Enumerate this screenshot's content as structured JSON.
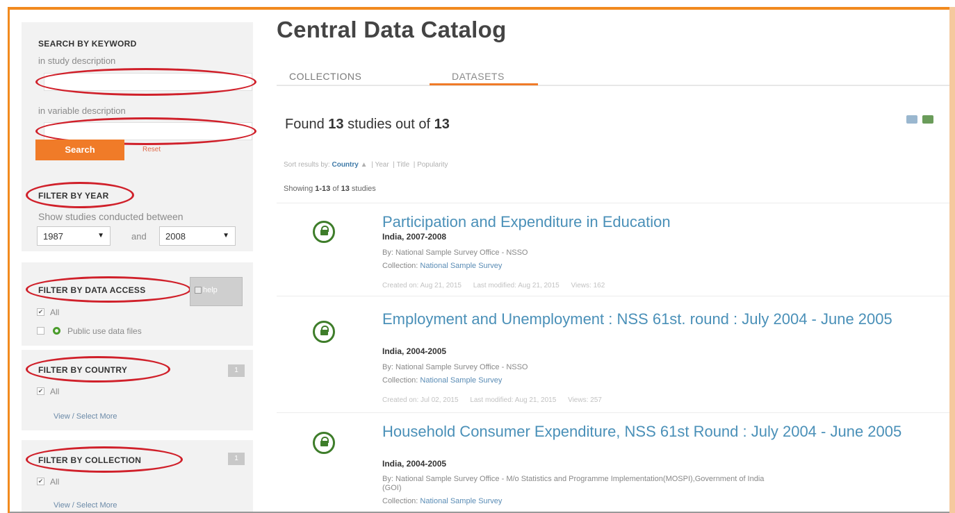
{
  "sidebar": {
    "keyword": {
      "title": "SEARCH BY KEYWORD",
      "study_label": "in study description",
      "variable_label": "in variable description",
      "study_value": "",
      "variable_value": "",
      "search_label": "Search",
      "reset_label": "Reset"
    },
    "year": {
      "title": "FILTER BY YEAR",
      "hint": "Show studies conducted between",
      "from": "1987",
      "and_label": "and",
      "to": "2008"
    },
    "access": {
      "title": "FILTER BY DATA ACCESS",
      "help_alt": "help",
      "all_label": "All",
      "public_label": "Public use data files"
    },
    "country": {
      "title": "FILTER BY COUNTRY",
      "count": "1",
      "all_label": "All",
      "more_label": "View / Select More"
    },
    "collection": {
      "title": "FILTER BY COLLECTION",
      "count": "1",
      "all_label": "All",
      "more_label": "View / Select More"
    }
  },
  "main": {
    "title": "Central Data Catalog",
    "tabs": [
      {
        "label": "COLLECTIONS"
      },
      {
        "label": "DATASETS"
      }
    ],
    "found": {
      "prefix": "Found",
      "count": "13",
      "mid": "studies out of",
      "total": "13"
    },
    "sort": {
      "prefix": "Sort results by:",
      "active": "Country",
      "arrow": "▲",
      "year": "Year",
      "title": "Title",
      "popularity": "Popularity"
    },
    "showing": {
      "prefix": "Showing",
      "range": "1-13",
      "of": "of",
      "total": "13",
      "suffix": "studies"
    },
    "studies": [
      {
        "title": "Participation and Expenditure in Education",
        "country": "India, 2007-2008",
        "by": "By: National Sample Survey Office - NSSO",
        "collection_prefix": "Collection:",
        "collection": "National Sample Survey",
        "created": "Created on: Aug 21, 2015",
        "modified": "Last modified: Aug 21, 2015",
        "views": "Views: 162"
      },
      {
        "title": "Employment and Unemployment : NSS 61st. round : July 2004 - June 2005",
        "country": "India, 2004-2005",
        "by": "By: National Sample Survey Office - NSSO",
        "collection_prefix": "Collection:",
        "collection": "National Sample Survey",
        "created": "Created on: Jul 02, 2015",
        "modified": "Last modified: Aug 21, 2015",
        "views": "Views: 257"
      },
      {
        "title": "Household Consumer Expenditure, NSS 61st Round : July 2004 - June 2005",
        "country": "India, 2004-2005",
        "by": "By: National Sample Survey Office - M/o Statistics and Programme Implementation(MOSPI),Government of India (GOI)",
        "collection_prefix": "Collection:",
        "collection": "National Sample Survey"
      }
    ]
  },
  "colors": {
    "accent": "#f07b28",
    "frame": "#f28a1e",
    "annotation": "#d0202a",
    "link": "#4a90b8",
    "lock": "#3e7d2a"
  }
}
